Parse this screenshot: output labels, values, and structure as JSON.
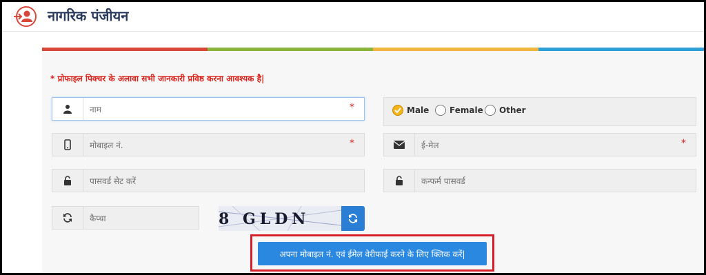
{
  "header": {
    "title": "नागरिक पंजीयन",
    "icon": "user-register-icon"
  },
  "notice": "* प्रोफाइल पिक्चर के अलावा सभी जानकारी प्रविष्ठ करना आवश्यक है|",
  "colors": {
    "strip": [
      "#d9463a",
      "#8bb43a",
      "#f0b53d",
      "#2f9fd8"
    ],
    "accent": "#2a88e0",
    "highlight_border": "#d71f2b"
  },
  "form": {
    "name": {
      "placeholder": "नाम",
      "required": "*"
    },
    "mobile": {
      "placeholder": "मोबाइल नं.",
      "required": "*"
    },
    "password": {
      "placeholder": "पासवर्ड सेट करें"
    },
    "captcha": {
      "placeholder": "कैप्चा",
      "image_text": "8 GLDN"
    },
    "email": {
      "placeholder": "ई-मेल",
      "required": "*"
    },
    "confirm_password": {
      "placeholder": "कन्फर्म पासवर्ड"
    },
    "gender": {
      "options": [
        "Male",
        "Female",
        "Other"
      ],
      "selected": "Male"
    }
  },
  "verify_button": "अपना मोबाइल नं. एवं ईमेल वेरीफाई करने के लिए क्लिक करें|"
}
